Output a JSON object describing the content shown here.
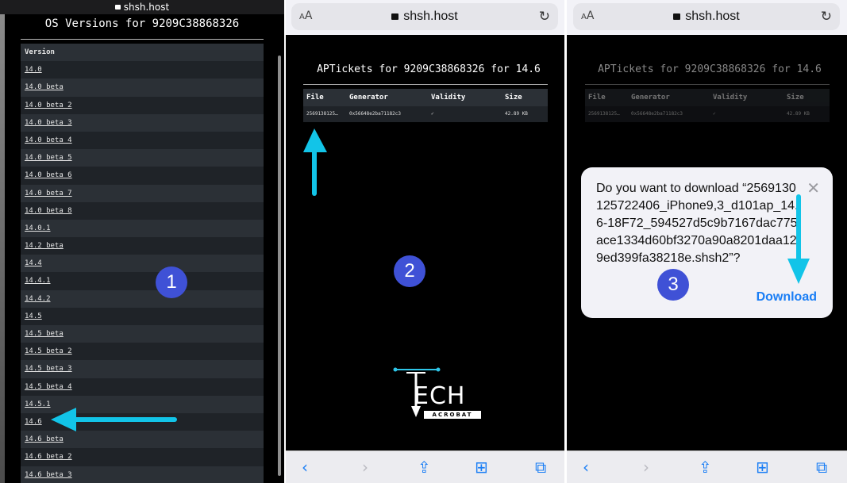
{
  "panel1": {
    "domain": "shsh.host",
    "title": "OS Versions for 9209C38868326",
    "header": "Version",
    "versions": [
      "14.0",
      "14.0 beta",
      "14.0 beta 2",
      "14.0 beta 3",
      "14.0 beta 4",
      "14.0 beta 5",
      "14.0 beta 6",
      "14.0 beta 7",
      "14.0 beta 8",
      "14.0.1",
      "14.2 beta",
      "14.4",
      "14.4.1",
      "14.4.2",
      "14.5",
      "14.5 beta",
      "14.5 beta 2",
      "14.5 beta 3",
      "14.5 beta 4",
      "14.5.1",
      "14.6",
      "14.6 beta",
      "14.6 beta 2",
      "14.6 beta 3"
    ],
    "step": "1"
  },
  "panel2": {
    "aa": "AA",
    "domain": "shsh.host",
    "title": "APTickets for 9209C38868326 for 14.6",
    "columns": [
      "File",
      "Generator",
      "Validity",
      "Size"
    ],
    "row": {
      "file": "2569138125…",
      "generator": "0x56648e2ba71182c3",
      "validity": "✓",
      "size": "42.89 KB"
    },
    "step": "2",
    "logo_text": "ECH",
    "logo_sub": "ACROBAT"
  },
  "panel3": {
    "aa": "AA",
    "domain": "shsh.host",
    "title": "APTickets for 9209C38868326 for 14.6",
    "columns": [
      "File",
      "Generator",
      "Validity",
      "Size"
    ],
    "row": {
      "file": "2569138125…",
      "generator": "0x56648e2ba71182c3",
      "validity": "✓",
      "size": "42.89 KB"
    },
    "dialog": {
      "message": "Do you want to download “2569130125722406_iPhone9,3_d101ap_14.6-18F72_594527d5c9b7167dac775ace1334d60bf3270a90a8201daa129ed399fa38218e.shsh2”?",
      "button": "Download"
    },
    "step": "3"
  },
  "colors": {
    "badge": "#3f51d6",
    "arrow": "#12c4e8",
    "link": "#1a7ef5"
  }
}
